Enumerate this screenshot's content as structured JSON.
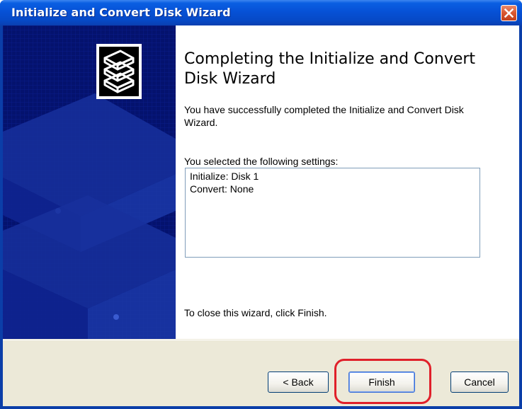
{
  "window": {
    "title": "Initialize and Convert Disk Wizard"
  },
  "titlebar": {
    "close_icon": "close-x-icon"
  },
  "sidebar": {
    "logo_icon": "disk-stack-icon"
  },
  "main": {
    "heading": "Completing the Initialize and Convert Disk Wizard",
    "description": "You have successfully completed the Initialize and Convert Disk Wizard.",
    "settings_label": "You selected the following settings:",
    "settings": [
      "Initialize: Disk 1",
      "Convert: None"
    ],
    "close_hint": "To close this wizard, click Finish."
  },
  "buttons": {
    "back": "< Back",
    "finish": "Finish",
    "cancel": "Cancel"
  },
  "colors": {
    "titlebar": "#0651d6",
    "sidebar": "#04126e",
    "footer": "#ece9d8",
    "highlight": "#e0202a"
  }
}
